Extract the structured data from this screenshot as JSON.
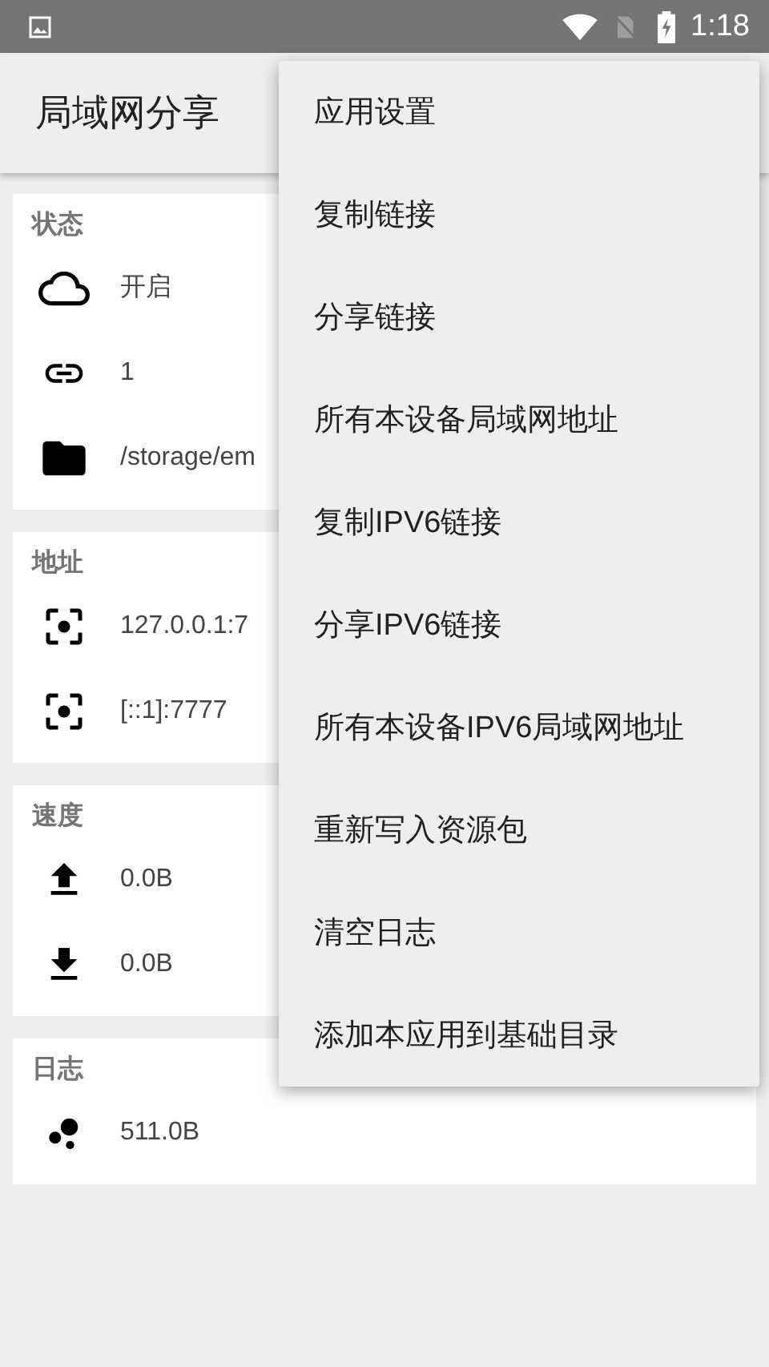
{
  "status_bar": {
    "time": "1:18"
  },
  "toolbar": {
    "title": "局域网分享"
  },
  "cards": [
    {
      "title": "状态",
      "rows": [
        {
          "kind": "cloud",
          "text": "开启"
        },
        {
          "kind": "link",
          "text": "1"
        },
        {
          "kind": "folder",
          "text": "/storage/em"
        }
      ]
    },
    {
      "title": "地址",
      "rows": [
        {
          "kind": "address",
          "text": "127.0.0.1:7"
        },
        {
          "kind": "address",
          "text": "[::1]:7777"
        }
      ]
    },
    {
      "title": "速度",
      "rows": [
        {
          "kind": "upload",
          "text": "0.0B"
        },
        {
          "kind": "download",
          "text": "0.0B"
        }
      ]
    },
    {
      "title": "日志",
      "rows": [
        {
          "kind": "bubbles",
          "text": "511.0B"
        }
      ]
    }
  ],
  "menu": {
    "items": [
      "应用设置",
      "复制链接",
      "分享链接",
      "所有本设备局域网地址",
      "复制IPV6链接",
      "分享IPV6链接",
      "所有本设备IPV6局域网地址",
      "重新写入资源包",
      "清空日志",
      "添加本应用到基础目录"
    ]
  }
}
